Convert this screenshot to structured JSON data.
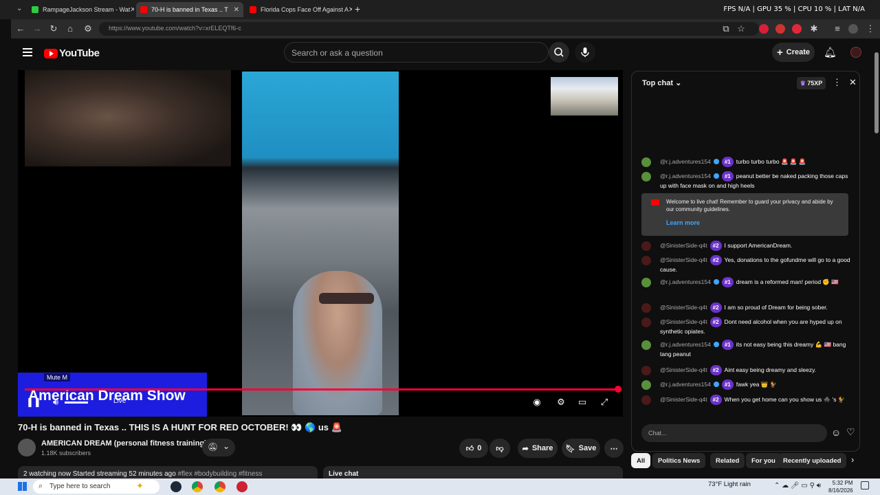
{
  "browser": {
    "tabs": [
      {
        "title": "RampageJackson Stream - Wat",
        "color": "#2ecc40"
      },
      {
        "title": "70-H is banned in Texas .. T",
        "color": "#ff0000"
      },
      {
        "title": "Florida Cops Face Off Against A",
        "color": "#ff0000"
      }
    ],
    "hud": "FPS N/A | GPU 35 % | CPU 10 % | LAT N/A",
    "url": "https://www.youtube.com/watch?v=xrELEQTf6-c"
  },
  "youtube": {
    "logo": "YouTube",
    "search_placeholder": "Search or ask a question",
    "create_label": "Create",
    "player": {
      "banner_title": "American Dream Show",
      "mute_tip": "Mute  M",
      "live_label": "Live",
      "progress": 1.0
    },
    "video": {
      "title": "70-H is banned in Texas .. THIS IS A HUNT FOR RED OCTOBER! 👀 🌎 us 🚨",
      "channel": "AMERICAN DREAM (personal fitness training)",
      "subscribers": "1.18K subscribers",
      "likes": "0",
      "share_label": "Share",
      "save_label": "Save",
      "desc_stats": "2 watching now  Started streaming 52 minutes ago",
      "desc_tags": "#flex #bodybuilding #fitness",
      "live_chat_label": "Live chat"
    },
    "chat": {
      "header": "Top chat",
      "xp": "75XP",
      "messages": [
        {
          "user": "@r.j.adventures154",
          "badge": "#1",
          "text": "turbo turbo turbo 🚨 🚨 🚨"
        },
        {
          "user": "@r.j.adventures154",
          "badge": "#1",
          "text": "peanut better be naked packing those caps up with face mask on and high heels"
        },
        {
          "user": "@SinisterSide-q4t",
          "badge": "#2",
          "text": "I support AmericanDream."
        },
        {
          "user": "@SinisterSide-q4t",
          "badge": "#2",
          "text": "Yes, donations to the gofundme will go to a good cause."
        },
        {
          "user": "@r.j.adventures154",
          "badge": "#1",
          "text": "dream is a reformed man! period ✊ 🇺🇸"
        },
        {
          "user": "@SinisterSide-q4t",
          "badge": "#2",
          "text": "I am so proud of Dream for being sober."
        },
        {
          "user": "@SinisterSide-q4t",
          "badge": "#2",
          "text": "Dont need alcohol when you are hyped up on synthetic opiates."
        },
        {
          "user": "@r.j.adventures154",
          "badge": "#1",
          "text": "its not easy being this dreamy 💪 🇺🇸 bang tang peanut"
        },
        {
          "user": "@SinisterSide-q4t",
          "badge": "#2",
          "text": "Aint easy being dreamy and sleezy."
        },
        {
          "user": "@r.j.adventures154",
          "badge": "#1",
          "text": "fawk yea 👑 🐓"
        },
        {
          "user": "@SinisterSide-q4t",
          "badge": "#2",
          "text": "When you get home can you show us 🕷️ 's 🐓"
        }
      ],
      "welcome": "Welcome to live chat! Remember to guard your privacy and abide by our community guidelines.",
      "learn_more": "Learn more",
      "input_placeholder": "Chat...",
      "chips": [
        "All",
        "Politics News",
        "Related",
        "For you",
        "Recently uploaded"
      ]
    }
  },
  "taskbar": {
    "search_placeholder": "Type here to search",
    "weather": "73°F  Light rain",
    "time": "5:32 PM",
    "date": "8/16/2026"
  }
}
